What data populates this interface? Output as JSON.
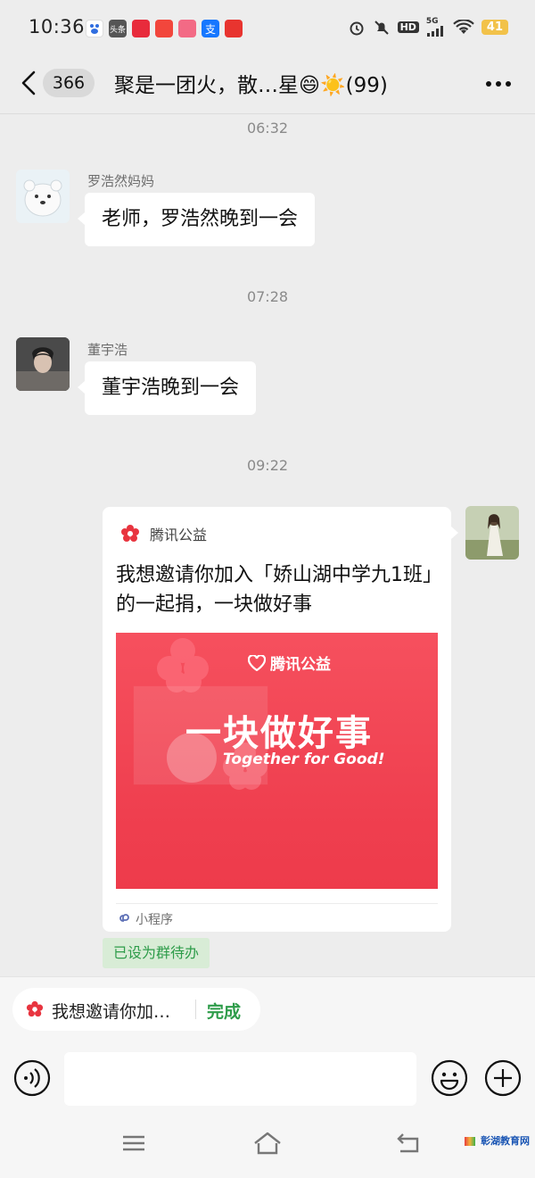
{
  "status_bar": {
    "time": "10:36",
    "notification_icons": [
      {
        "icon": "baidu-icon",
        "text": "",
        "color": "#2f6de0"
      },
      {
        "icon": "toutiao-icon",
        "text": "头条",
        "color": "#555555"
      },
      {
        "icon": "app-icon",
        "text": "",
        "color": "#e82b3c"
      },
      {
        "icon": "app-icon",
        "text": "",
        "color": "#f2463c"
      },
      {
        "icon": "app-icon",
        "text": "",
        "color": "#f36a85"
      },
      {
        "icon": "alipay-icon",
        "text": "支",
        "color": "#1677ff"
      },
      {
        "icon": "app-icon",
        "text": "",
        "color": "#e8342f"
      }
    ],
    "network_label": "5G",
    "hd_label": "HD",
    "battery": "41"
  },
  "header": {
    "unread_count": "366",
    "title": "聚是一团火，散…星😄☀️(99)"
  },
  "messages": [
    {
      "type": "time",
      "text": "06:32"
    },
    {
      "type": "incoming",
      "sender": "罗浩然妈妈",
      "text": "老师，罗浩然晚到一会"
    },
    {
      "type": "time",
      "text": "07:28"
    },
    {
      "type": "incoming",
      "sender": "董宇浩",
      "text": "董宇浩晚到一会"
    },
    {
      "type": "time",
      "text": "09:22"
    }
  ],
  "card": {
    "source": "腾讯公益",
    "title": "我想邀请你加入「娇山湖中学九1班」的一起捐，一块做好事",
    "image_brand": "腾讯公益",
    "image_slogan": "一块做好事",
    "image_tagline": "Together for Good!",
    "footer": "小程序",
    "todo_tag": "已设为群待办"
  },
  "quote_bar": {
    "text": "我想邀请你加…",
    "done_label": "完成"
  },
  "watermark": "彰湖教育网",
  "colors": {
    "background": "#ededed",
    "accent_green": "#2e9c4a",
    "brand_red": "#ee3b4b"
  }
}
